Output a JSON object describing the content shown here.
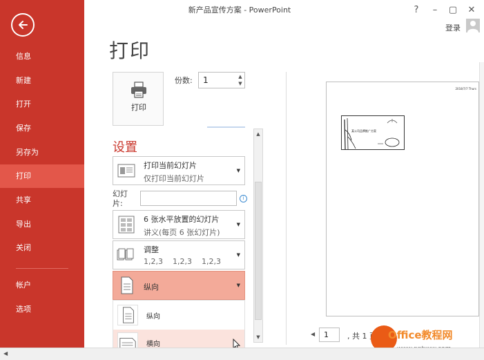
{
  "window": {
    "title": "新产品宣传方案 - PowerPoint",
    "help": "?",
    "minimize": "–",
    "restore": "▢",
    "close": "✕",
    "login": "登录"
  },
  "sidebar": {
    "items": [
      {
        "label": "信息"
      },
      {
        "label": "新建"
      },
      {
        "label": "打开"
      },
      {
        "label": "保存"
      },
      {
        "label": "另存为"
      },
      {
        "label": "打印"
      },
      {
        "label": "共享"
      },
      {
        "label": "导出"
      },
      {
        "label": "关闭"
      },
      {
        "label": "帐户"
      },
      {
        "label": "选项"
      }
    ],
    "active": "打印"
  },
  "print": {
    "title": "打印",
    "button_label": "打印",
    "copies_label": "份数:",
    "copies_value": "1"
  },
  "settings": {
    "header": "设置",
    "range": {
      "main": "打印当前幻灯片",
      "sub": "仅打印当前幻灯片"
    },
    "slides_label": "幻灯片:",
    "slides_value": "",
    "info": "i",
    "layout": {
      "main": "6 张水平放置的幻灯片",
      "sub": "讲义(每页 6 张幻灯片)"
    },
    "collate": {
      "main": "调整",
      "sub": [
        "1,2,3",
        "1,2,3",
        "1,2,3"
      ]
    },
    "orientation": {
      "main": "纵向"
    },
    "orientation_options": [
      "纵向",
      "横向"
    ]
  },
  "preview": {
    "date": "2018/7/7 Thurs",
    "slide_text": "某公司品牌推广方案",
    "page_current": "1",
    "page_total": ", 共 1 页"
  },
  "watermark": {
    "title": "Office教程网",
    "url": "www.pptxxw.com"
  },
  "colors": {
    "accent": "#c9362b",
    "nav_active": "#e3574a",
    "highlight": "#f4b6a8"
  }
}
